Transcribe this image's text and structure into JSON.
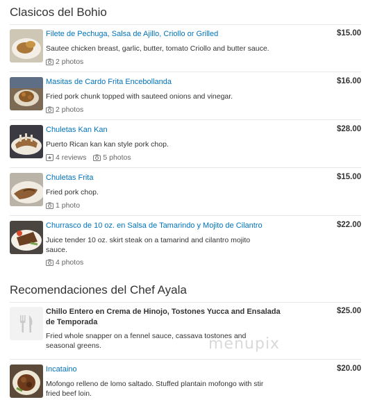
{
  "sections": [
    {
      "title": "Clasicos del Bohio",
      "items": [
        {
          "name": "Filete de Pechuga, Salsa de Ajillo, Criollo or Grilled",
          "desc": "Sautee chicken breast, garlic, butter, tomato Criollo and butter sauce.",
          "photos": "2 photos",
          "price": "$15.00"
        },
        {
          "name": "Masitas de Cardo Frita Encebollanda",
          "desc": "Fried pork chunk topped with sauteed onions and vinegar.",
          "photos": "2 photos",
          "price": "$16.00"
        },
        {
          "name": "Chuletas Kan Kan",
          "desc": "Puerto Rican kan kan style pork chop.",
          "reviews": "4 reviews",
          "photos": "5 photos",
          "price": "$28.00"
        },
        {
          "name": "Chuletas Frita",
          "desc": "Fried pork chop.",
          "photos": "1 photo",
          "price": "$15.00"
        },
        {
          "name": "Churrasco de 10 oz. en Salsa de Tamarindo y Mojito de Cilantro",
          "desc_line1": "Juice tender 10 oz. skirt steak on a tamarind and cilantro mojito",
          "desc_line2": "sauce.",
          "photos": "4 photos",
          "price": "$22.00"
        }
      ]
    },
    {
      "title": "Recomendaciones del Chef Ayala",
      "items": [
        {
          "name_line1": "Chillo Entero en Crema de Hinojo, Tostones Yucca and Ensalada",
          "name_line2": "de Temporada",
          "desc_line1": "Fried whole snapper on a fennel sauce, cassava tostones and",
          "desc_line2": "seasonal greens.",
          "price": "$25.00"
        },
        {
          "name": "Incataino",
          "desc_line1": "Mofongo relleno de lomo saltado. Stuffed plantain mofongo with stir",
          "desc_line2": "fried beef loin.",
          "price": "$20.00"
        }
      ]
    }
  ],
  "watermark": "menupix",
  "icons": {
    "camera": "camera-icon",
    "review": "review-icon",
    "placeholder": "fork-knife-icon"
  }
}
